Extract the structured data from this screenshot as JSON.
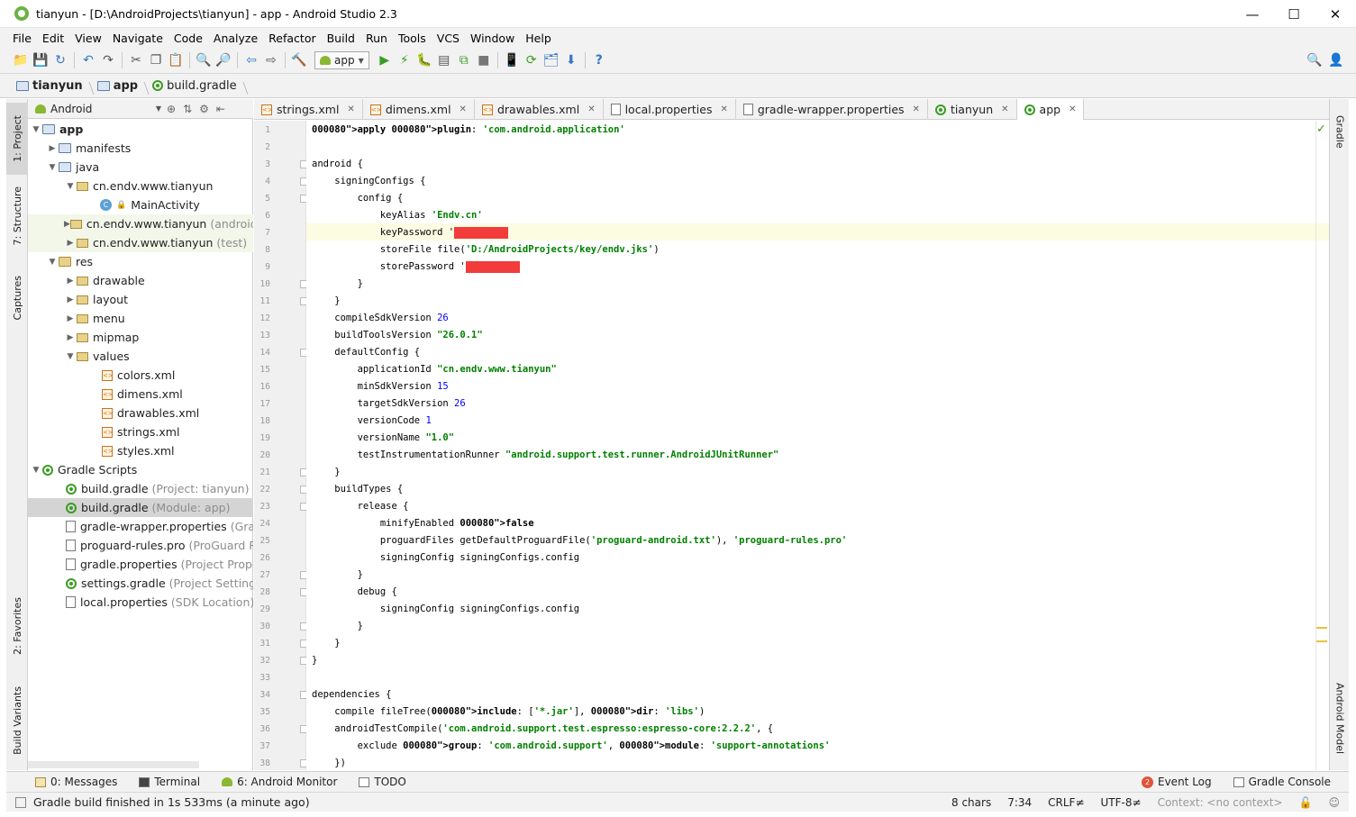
{
  "window": {
    "title": "tianyun - [D:\\AndroidProjects\\tianyun] - app - Android Studio 2.3"
  },
  "menu": [
    "File",
    "Edit",
    "View",
    "Navigate",
    "Code",
    "Analyze",
    "Refactor",
    "Build",
    "Run",
    "Tools",
    "VCS",
    "Window",
    "Help"
  ],
  "toolbar": {
    "run_config": "app"
  },
  "breadcrumb": [
    "tianyun",
    "app",
    "build.gradle"
  ],
  "left_tools": [
    "1: Project",
    "7: Structure",
    "Captures",
    "2: Favorites",
    "Build Variants"
  ],
  "right_tools": [
    "Gradle",
    "Android Model"
  ],
  "project_panel": {
    "view_mode": "Android",
    "tree": [
      {
        "label": "app",
        "extra": ""
      },
      {
        "label": "manifests",
        "extra": ""
      },
      {
        "label": "java",
        "extra": ""
      },
      {
        "label": "cn.endv.www.tianyun",
        "extra": ""
      },
      {
        "label": "MainActivity",
        "extra": ""
      },
      {
        "label": "cn.endv.www.tianyun",
        "extra": "(androidTest)"
      },
      {
        "label": "cn.endv.www.tianyun",
        "extra": "(test)"
      },
      {
        "label": "res",
        "extra": ""
      },
      {
        "label": "drawable",
        "extra": ""
      },
      {
        "label": "layout",
        "extra": ""
      },
      {
        "label": "menu",
        "extra": ""
      },
      {
        "label": "mipmap",
        "extra": ""
      },
      {
        "label": "values",
        "extra": ""
      },
      {
        "label": "colors.xml",
        "extra": ""
      },
      {
        "label": "dimens.xml",
        "extra": ""
      },
      {
        "label": "drawables.xml",
        "extra": ""
      },
      {
        "label": "strings.xml",
        "extra": ""
      },
      {
        "label": "styles.xml",
        "extra": ""
      },
      {
        "label": "Gradle Scripts",
        "extra": ""
      },
      {
        "label": "build.gradle",
        "extra": "(Project: tianyun)"
      },
      {
        "label": "build.gradle",
        "extra": "(Module: app)"
      },
      {
        "label": "gradle-wrapper.properties",
        "extra": "(Gradle Version)"
      },
      {
        "label": "proguard-rules.pro",
        "extra": "(ProGuard Rules for app)"
      },
      {
        "label": "gradle.properties",
        "extra": "(Project Properties)"
      },
      {
        "label": "settings.gradle",
        "extra": "(Project Settings)"
      },
      {
        "label": "local.properties",
        "extra": "(SDK Location)"
      }
    ]
  },
  "tabs": [
    "strings.xml",
    "dimens.xml",
    "drawables.xml",
    "local.properties",
    "gradle-wrapper.properties",
    "tianyun",
    "app"
  ],
  "editor": {
    "lines": [
      "apply plugin: 'com.android.application'",
      "",
      "android {",
      "    signingConfigs {",
      "        config {",
      "            keyAlias 'Endv.cn'",
      "            keyPassword '",
      "            storeFile file('D:/AndroidProjects/key/endv.jks')",
      "            storePassword '",
      "        }",
      "    }",
      "    compileSdkVersion 26",
      "    buildToolsVersion \"26.0.1\"",
      "    defaultConfig {",
      "        applicationId \"cn.endv.www.tianyun\"",
      "        minSdkVersion 15",
      "        targetSdkVersion 26",
      "        versionCode 1",
      "        versionName \"1.0\"",
      "        testInstrumentationRunner \"android.support.test.runner.AndroidJUnitRunner\"",
      "    }",
      "    buildTypes {",
      "        release {",
      "            minifyEnabled false",
      "            proguardFiles getDefaultProguardFile('proguard-android.txt'), 'proguard-rules.pro'",
      "            signingConfig signingConfigs.config",
      "        }",
      "        debug {",
      "            signingConfig signingConfigs.config",
      "        }",
      "    }",
      "}",
      "",
      "dependencies {",
      "    compile fileTree(include: ['*.jar'], dir: 'libs')",
      "    androidTestCompile('com.android.support.test.espresso:espresso-core:2.2.2', {",
      "        exclude group: 'com.android.support', module: 'support-annotations'",
      "    })"
    ]
  },
  "bottom_tools": [
    "0: Messages",
    "Terminal",
    "6: Android Monitor",
    "TODO",
    "Event Log",
    "Gradle Console"
  ],
  "status": {
    "message": "Gradle build finished in 1s 533ms (a minute ago)",
    "chars": "8 chars",
    "position": "7:34",
    "line_sep": "CRLF≠",
    "encoding": "UTF-8≠",
    "context": "Context: <no context>"
  }
}
